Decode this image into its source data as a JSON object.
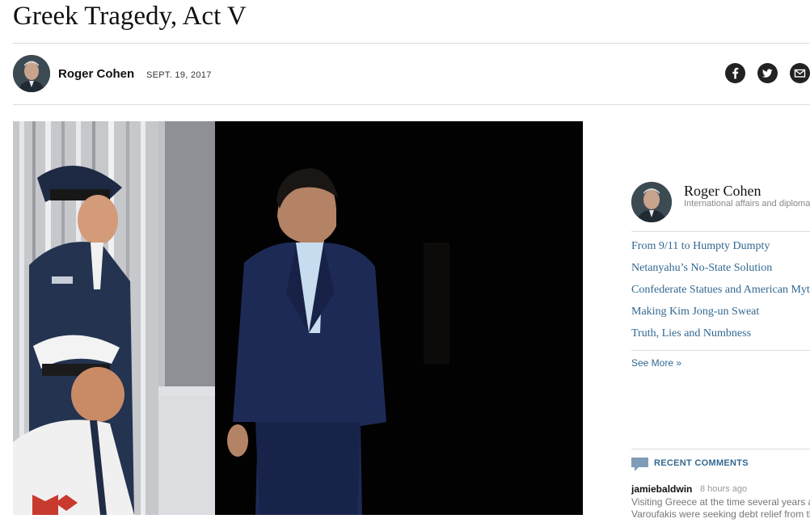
{
  "article": {
    "headline": "Greek Tragedy, Act V",
    "author": "Roger Cohen",
    "date": "SEPT. 19, 2017"
  },
  "share": {
    "icons": [
      "facebook-icon",
      "twitter-icon",
      "email-icon"
    ]
  },
  "sidebar": {
    "author_name": "Roger Cohen",
    "author_desc": "International affairs and diplomacy",
    "more_columns": [
      "From 9/11 to Humpty Dumpty",
      "Netanyahu’s No-State Solution",
      "Confederate Statues and American Myth",
      "Making Kim Jong-un Sweat",
      "Truth, Lies and Numbness"
    ],
    "see_more": "See More »"
  },
  "comments": {
    "label": "RECENT COMMENTS",
    "items": [
      {
        "user": "jamiebaldwin",
        "time": "8 hours ago",
        "lines": [
          "Visiting Greece at the time several years ago when",
          "Varoufakis were seeking debt relief from the troika"
        ]
      }
    ]
  },
  "colors": {
    "link": "#326891",
    "rule": "#dcdcdc",
    "share_bg": "#222222"
  }
}
